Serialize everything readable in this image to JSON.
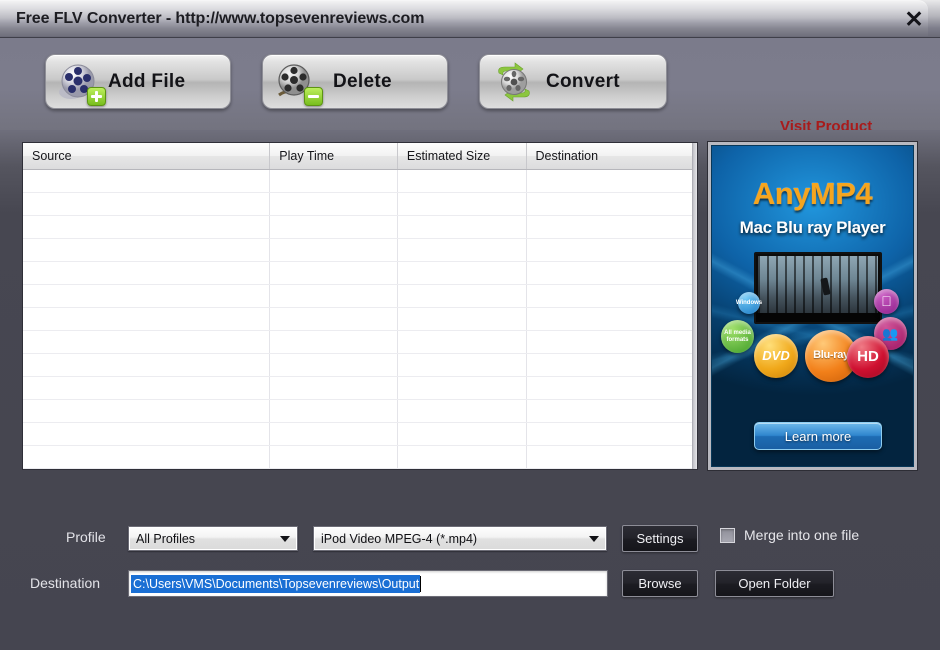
{
  "window": {
    "title": "Free FLV Converter - http://www.topsevenreviews.com",
    "close_label": "✕"
  },
  "toolbar": {
    "buttons": [
      {
        "name": "add-file",
        "label": "Add File",
        "icon": "film-reel-plus-icon"
      },
      {
        "name": "delete",
        "label": "Delete",
        "icon": "film-reel-minus-icon"
      },
      {
        "name": "convert",
        "label": "Convert",
        "icon": "convert-recycle-icon"
      }
    ],
    "visit_product": "Visit Product",
    "visit_product_color": "#a81b1b"
  },
  "filelist": {
    "columns": [
      "Source",
      "Play Time",
      "Estimated Size",
      "Destination"
    ],
    "rows": [],
    "empty_row_count": 13
  },
  "ad": {
    "brand": "AnyMP4",
    "product": "Mac Blu ray Player",
    "brand_color": "#f5a51e",
    "cta": "Learn more",
    "badges": [
      {
        "name": "windows",
        "text": "Windows"
      },
      {
        "name": "all-media-formats",
        "text": "All media formats"
      },
      {
        "name": "apple",
        "text": ""
      },
      {
        "name": "multi-user",
        "text": ""
      },
      {
        "name": "dvd",
        "text": "DVD"
      },
      {
        "name": "blu-ray",
        "text": "Blu-ray"
      },
      {
        "name": "hd",
        "text": "HD"
      }
    ]
  },
  "bottom": {
    "profile_label": "Profile",
    "profile_category": "All Profiles",
    "profile_format": "iPod Video MPEG-4 (*.mp4)",
    "settings_label": "Settings",
    "merge_label": "Merge into one file",
    "merge_checked": false,
    "destination_label": "Destination",
    "destination_value": "C:\\Users\\VMS\\Documents\\Topsevenreviews\\Output",
    "destination_selected": true,
    "selection_color": "#1a6fd4",
    "browse_label": "Browse",
    "open_folder_label": "Open Folder"
  }
}
